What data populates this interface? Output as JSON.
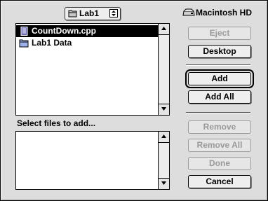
{
  "folder_popup": {
    "label": "Lab1",
    "icon": "folder-icon"
  },
  "file_list": {
    "items": [
      {
        "label": "CountDown.cpp",
        "icon": "document-icon",
        "selected": true
      },
      {
        "label": "Lab1 Data",
        "icon": "folder-icon",
        "selected": false
      }
    ]
  },
  "section_label": "Select files to add...",
  "volume": {
    "label": "Macintosh HD",
    "icon": "hard-disk-icon"
  },
  "buttons": {
    "eject": "Eject",
    "desktop": "Desktop",
    "add": "Add",
    "add_all": "Add All",
    "remove": "Remove",
    "remove_all": "Remove All",
    "done": "Done",
    "cancel": "Cancel"
  },
  "button_states": {
    "eject": "disabled",
    "remove": "disabled",
    "remove_all": "disabled",
    "done": "disabled"
  }
}
